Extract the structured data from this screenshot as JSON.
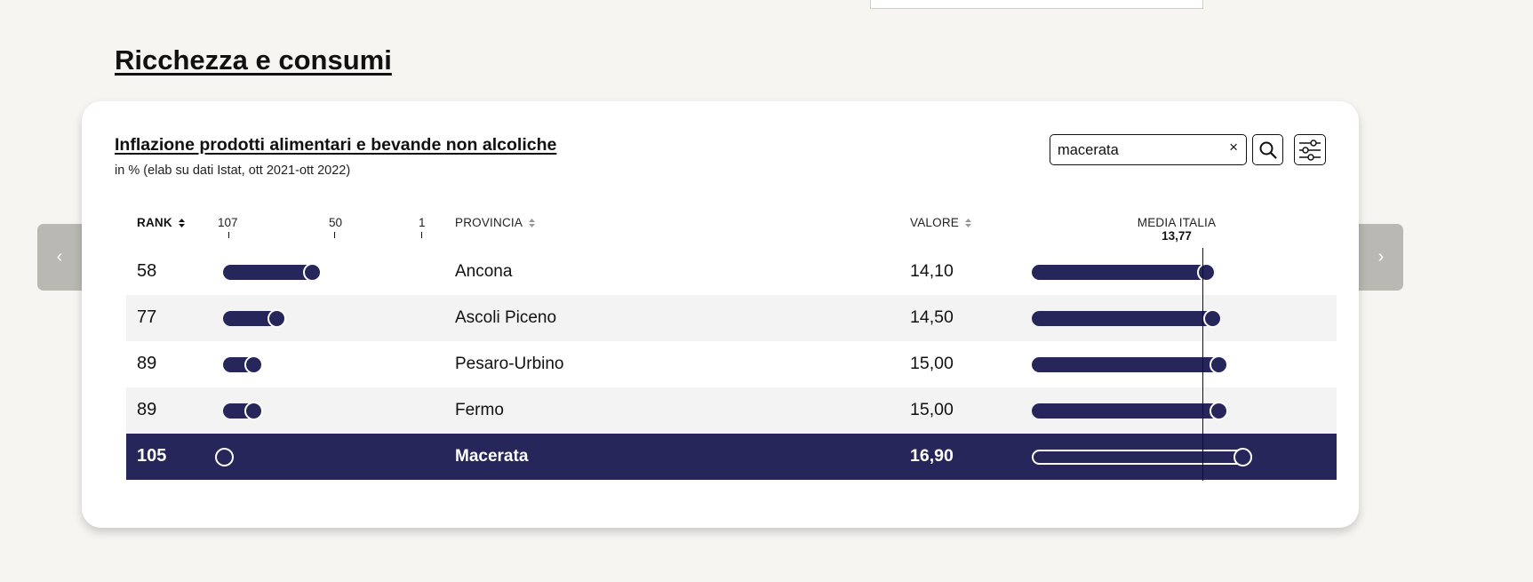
{
  "page": {
    "section_title": "Ricchezza e consumi",
    "prev_label": "‹",
    "next_label": "›"
  },
  "card": {
    "title": "Inflazione prodotti alimentari e bevande non alcoliche",
    "subtitle": "in % (elab su dati Istat, ott 2021-ott 2022)"
  },
  "search": {
    "value": "macerata",
    "placeholder": "",
    "clear_label": "×"
  },
  "table": {
    "headers": {
      "rank": "RANK",
      "provincia": "PROVINCIA",
      "valore": "VALORE",
      "media_label": "MEDIA ITALIA",
      "media_value": "13,77"
    },
    "rank_ticks": [
      "107",
      "50",
      "1"
    ],
    "rows": [
      {
        "rank": "58",
        "provincia": "Ancona",
        "valore": "14,10",
        "highlighted": false
      },
      {
        "rank": "77",
        "provincia": "Ascoli Piceno",
        "valore": "14,50",
        "highlighted": false
      },
      {
        "rank": "89",
        "provincia": "Pesaro-Urbino",
        "valore": "15,00",
        "highlighted": false
      },
      {
        "rank": "89",
        "provincia": "Fermo",
        "valore": "15,00",
        "highlighted": false
      },
      {
        "rank": "105",
        "provincia": "Macerata",
        "valore": "16,90",
        "highlighted": true
      }
    ]
  },
  "colors": {
    "accent": "#26265b",
    "card_bg": "#ffffff",
    "page_bg": "#f6f5f2",
    "nav_bg": "#b9b8b2"
  }
}
